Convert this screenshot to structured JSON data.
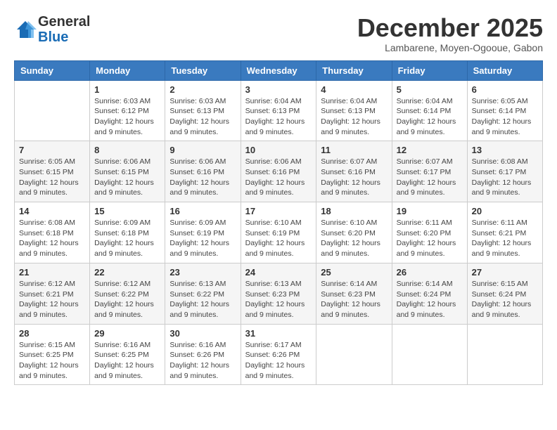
{
  "header": {
    "logo_general": "General",
    "logo_blue": "Blue",
    "month_title": "December 2025",
    "location": "Lambarene, Moyen-Ogooue, Gabon"
  },
  "days_of_week": [
    "Sunday",
    "Monday",
    "Tuesday",
    "Wednesday",
    "Thursday",
    "Friday",
    "Saturday"
  ],
  "weeks": [
    [
      {
        "day": "",
        "sunrise": "",
        "sunset": "",
        "daylight": ""
      },
      {
        "day": "1",
        "sunrise": "Sunrise: 6:03 AM",
        "sunset": "Sunset: 6:12 PM",
        "daylight": "Daylight: 12 hours and 9 minutes."
      },
      {
        "day": "2",
        "sunrise": "Sunrise: 6:03 AM",
        "sunset": "Sunset: 6:13 PM",
        "daylight": "Daylight: 12 hours and 9 minutes."
      },
      {
        "day": "3",
        "sunrise": "Sunrise: 6:04 AM",
        "sunset": "Sunset: 6:13 PM",
        "daylight": "Daylight: 12 hours and 9 minutes."
      },
      {
        "day": "4",
        "sunrise": "Sunrise: 6:04 AM",
        "sunset": "Sunset: 6:13 PM",
        "daylight": "Daylight: 12 hours and 9 minutes."
      },
      {
        "day": "5",
        "sunrise": "Sunrise: 6:04 AM",
        "sunset": "Sunset: 6:14 PM",
        "daylight": "Daylight: 12 hours and 9 minutes."
      },
      {
        "day": "6",
        "sunrise": "Sunrise: 6:05 AM",
        "sunset": "Sunset: 6:14 PM",
        "daylight": "Daylight: 12 hours and 9 minutes."
      }
    ],
    [
      {
        "day": "7",
        "sunrise": "Sunrise: 6:05 AM",
        "sunset": "Sunset: 6:15 PM",
        "daylight": "Daylight: 12 hours and 9 minutes."
      },
      {
        "day": "8",
        "sunrise": "Sunrise: 6:06 AM",
        "sunset": "Sunset: 6:15 PM",
        "daylight": "Daylight: 12 hours and 9 minutes."
      },
      {
        "day": "9",
        "sunrise": "Sunrise: 6:06 AM",
        "sunset": "Sunset: 6:16 PM",
        "daylight": "Daylight: 12 hours and 9 minutes."
      },
      {
        "day": "10",
        "sunrise": "Sunrise: 6:06 AM",
        "sunset": "Sunset: 6:16 PM",
        "daylight": "Daylight: 12 hours and 9 minutes."
      },
      {
        "day": "11",
        "sunrise": "Sunrise: 6:07 AM",
        "sunset": "Sunset: 6:16 PM",
        "daylight": "Daylight: 12 hours and 9 minutes."
      },
      {
        "day": "12",
        "sunrise": "Sunrise: 6:07 AM",
        "sunset": "Sunset: 6:17 PM",
        "daylight": "Daylight: 12 hours and 9 minutes."
      },
      {
        "day": "13",
        "sunrise": "Sunrise: 6:08 AM",
        "sunset": "Sunset: 6:17 PM",
        "daylight": "Daylight: 12 hours and 9 minutes."
      }
    ],
    [
      {
        "day": "14",
        "sunrise": "Sunrise: 6:08 AM",
        "sunset": "Sunset: 6:18 PM",
        "daylight": "Daylight: 12 hours and 9 minutes."
      },
      {
        "day": "15",
        "sunrise": "Sunrise: 6:09 AM",
        "sunset": "Sunset: 6:18 PM",
        "daylight": "Daylight: 12 hours and 9 minutes."
      },
      {
        "day": "16",
        "sunrise": "Sunrise: 6:09 AM",
        "sunset": "Sunset: 6:19 PM",
        "daylight": "Daylight: 12 hours and 9 minutes."
      },
      {
        "day": "17",
        "sunrise": "Sunrise: 6:10 AM",
        "sunset": "Sunset: 6:19 PM",
        "daylight": "Daylight: 12 hours and 9 minutes."
      },
      {
        "day": "18",
        "sunrise": "Sunrise: 6:10 AM",
        "sunset": "Sunset: 6:20 PM",
        "daylight": "Daylight: 12 hours and 9 minutes."
      },
      {
        "day": "19",
        "sunrise": "Sunrise: 6:11 AM",
        "sunset": "Sunset: 6:20 PM",
        "daylight": "Daylight: 12 hours and 9 minutes."
      },
      {
        "day": "20",
        "sunrise": "Sunrise: 6:11 AM",
        "sunset": "Sunset: 6:21 PM",
        "daylight": "Daylight: 12 hours and 9 minutes."
      }
    ],
    [
      {
        "day": "21",
        "sunrise": "Sunrise: 6:12 AM",
        "sunset": "Sunset: 6:21 PM",
        "daylight": "Daylight: 12 hours and 9 minutes."
      },
      {
        "day": "22",
        "sunrise": "Sunrise: 6:12 AM",
        "sunset": "Sunset: 6:22 PM",
        "daylight": "Daylight: 12 hours and 9 minutes."
      },
      {
        "day": "23",
        "sunrise": "Sunrise: 6:13 AM",
        "sunset": "Sunset: 6:22 PM",
        "daylight": "Daylight: 12 hours and 9 minutes."
      },
      {
        "day": "24",
        "sunrise": "Sunrise: 6:13 AM",
        "sunset": "Sunset: 6:23 PM",
        "daylight": "Daylight: 12 hours and 9 minutes."
      },
      {
        "day": "25",
        "sunrise": "Sunrise: 6:14 AM",
        "sunset": "Sunset: 6:23 PM",
        "daylight": "Daylight: 12 hours and 9 minutes."
      },
      {
        "day": "26",
        "sunrise": "Sunrise: 6:14 AM",
        "sunset": "Sunset: 6:24 PM",
        "daylight": "Daylight: 12 hours and 9 minutes."
      },
      {
        "day": "27",
        "sunrise": "Sunrise: 6:15 AM",
        "sunset": "Sunset: 6:24 PM",
        "daylight": "Daylight: 12 hours and 9 minutes."
      }
    ],
    [
      {
        "day": "28",
        "sunrise": "Sunrise: 6:15 AM",
        "sunset": "Sunset: 6:25 PM",
        "daylight": "Daylight: 12 hours and 9 minutes."
      },
      {
        "day": "29",
        "sunrise": "Sunrise: 6:16 AM",
        "sunset": "Sunset: 6:25 PM",
        "daylight": "Daylight: 12 hours and 9 minutes."
      },
      {
        "day": "30",
        "sunrise": "Sunrise: 6:16 AM",
        "sunset": "Sunset: 6:26 PM",
        "daylight": "Daylight: 12 hours and 9 minutes."
      },
      {
        "day": "31",
        "sunrise": "Sunrise: 6:17 AM",
        "sunset": "Sunset: 6:26 PM",
        "daylight": "Daylight: 12 hours and 9 minutes."
      },
      {
        "day": "",
        "sunrise": "",
        "sunset": "",
        "daylight": ""
      },
      {
        "day": "",
        "sunrise": "",
        "sunset": "",
        "daylight": ""
      },
      {
        "day": "",
        "sunrise": "",
        "sunset": "",
        "daylight": ""
      }
    ]
  ]
}
